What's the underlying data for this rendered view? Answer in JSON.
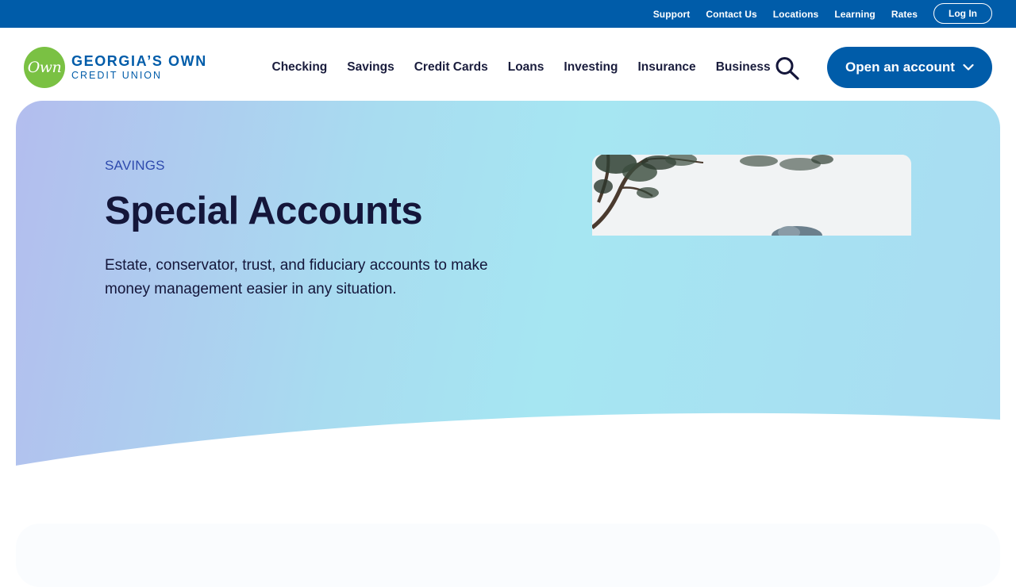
{
  "utility_nav": {
    "links": [
      "Support",
      "Contact Us",
      "Locations",
      "Learning",
      "Rates"
    ],
    "login_label": "Log In"
  },
  "brand": {
    "logo_mark": "Own",
    "name_line1": "GEORGIA’S OWN",
    "name_line2": "CREDIT UNION"
  },
  "main_nav": {
    "items": [
      "Checking",
      "Savings",
      "Credit Cards",
      "Loans",
      "Investing",
      "Insurance",
      "Business"
    ],
    "search_icon": "search-icon",
    "cta_label": "Open an account",
    "cta_icon": "chevron-down-icon"
  },
  "hero": {
    "eyebrow": "SAVINGS",
    "title": "Special Accounts",
    "description": "Estate, conservator, trust, and fiduciary accounts to make money management easier in any situation."
  },
  "colors": {
    "brand_blue": "#005ca9",
    "brand_green": "#7ac143",
    "eyebrow_blue": "#2e4aad",
    "heading_navy": "#14163a"
  }
}
